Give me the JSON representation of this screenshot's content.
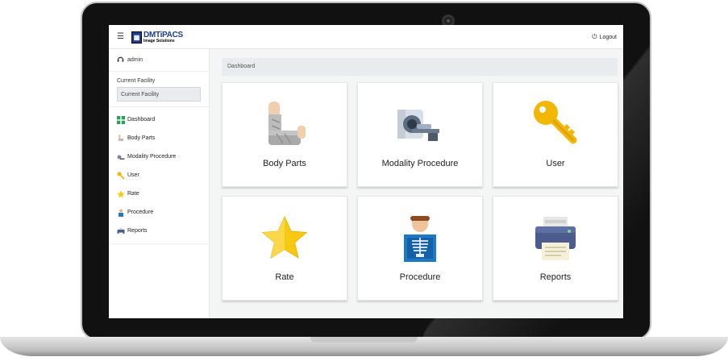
{
  "header": {
    "logo_main": "DMTiPACS",
    "logo_sub": "Image Solutions",
    "logout_label": "Logout",
    "menu_icon": "hamburger-icon",
    "logout_icon": "power-icon"
  },
  "sidebar": {
    "user_name": "admin",
    "facility_label": "Current Facility",
    "facility_placeholder": "Current Facility",
    "items": [
      {
        "label": "Dashboard",
        "icon": "dashboard-grid-icon"
      },
      {
        "label": "Body Parts",
        "icon": "arm-cast-icon"
      },
      {
        "label": "Modality Procedure",
        "icon": "scanner-icon"
      },
      {
        "label": "User",
        "icon": "key-icon"
      },
      {
        "label": "Rate",
        "icon": "star-icon"
      },
      {
        "label": "Procedure",
        "icon": "xray-person-icon"
      },
      {
        "label": "Reports",
        "icon": "printer-icon"
      }
    ]
  },
  "breadcrumb": "Dashboard",
  "cards": [
    {
      "title": "Body Parts",
      "icon": "arm-cast-icon"
    },
    {
      "title": "Modality Procedure",
      "icon": "scanner-icon"
    },
    {
      "title": "User",
      "icon": "key-icon"
    },
    {
      "title": "Rate",
      "icon": "star-icon"
    },
    {
      "title": "Procedure",
      "icon": "xray-person-icon"
    },
    {
      "title": "Reports",
      "icon": "printer-icon"
    }
  ],
  "colors": {
    "brand": "#1f3c88",
    "key": "#f2b705",
    "star": "#f7c911"
  }
}
